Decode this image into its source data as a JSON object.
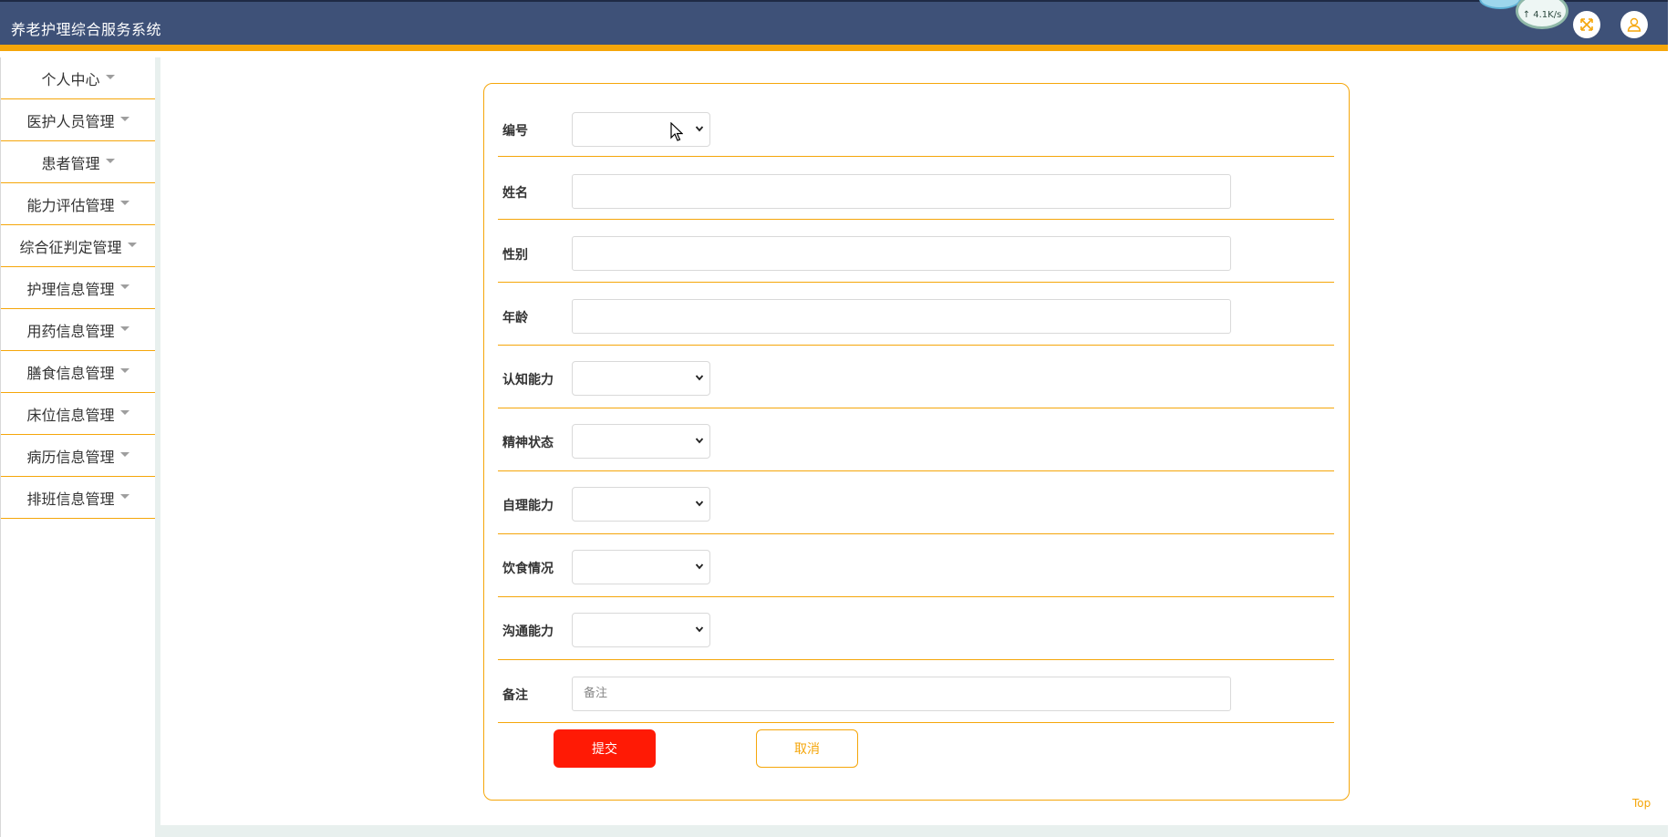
{
  "header": {
    "title": "养老护理综合服务系统",
    "net_speed": "↑ 4.1K/s"
  },
  "sidebar": {
    "items": [
      {
        "label": "个人中心"
      },
      {
        "label": "医护人员管理"
      },
      {
        "label": "患者管理"
      },
      {
        "label": "能力评估管理"
      },
      {
        "label": "综合征判定管理"
      },
      {
        "label": "护理信息管理"
      },
      {
        "label": "用药信息管理"
      },
      {
        "label": "膳食信息管理"
      },
      {
        "label": "床位信息管理"
      },
      {
        "label": "病历信息管理"
      },
      {
        "label": "排班信息管理"
      }
    ]
  },
  "form": {
    "fields": {
      "number": {
        "label": "编号",
        "value": ""
      },
      "name": {
        "label": "姓名",
        "value": ""
      },
      "gender": {
        "label": "性别",
        "value": ""
      },
      "age": {
        "label": "年龄",
        "value": ""
      },
      "cognitive": {
        "label": "认知能力",
        "value": ""
      },
      "mental": {
        "label": "精神状态",
        "value": ""
      },
      "selfcare": {
        "label": "自理能力",
        "value": ""
      },
      "diet": {
        "label": "饮食情况",
        "value": ""
      },
      "communication": {
        "label": "沟通能力",
        "value": ""
      },
      "remark": {
        "label": "备注",
        "placeholder": "备注",
        "value": ""
      }
    },
    "submit_label": "提交",
    "cancel_label": "取消"
  },
  "footer": {
    "top_label": "Top"
  },
  "colors": {
    "header_bg": "#3e5178",
    "accent": "#f5a60a",
    "submit": "#ff1a05"
  }
}
